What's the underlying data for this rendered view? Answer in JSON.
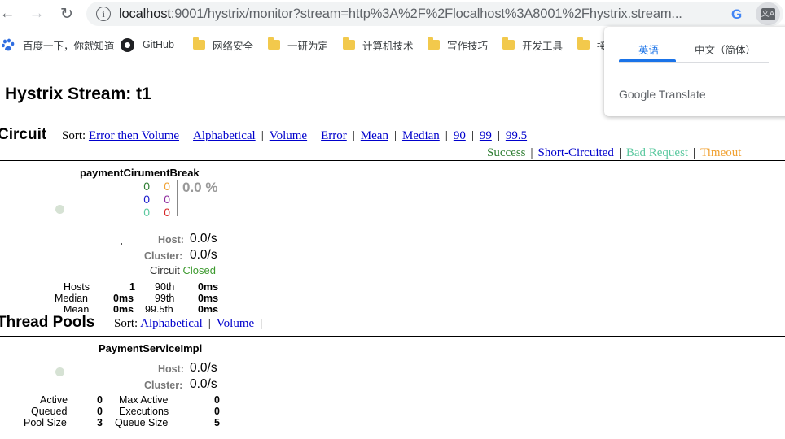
{
  "browser": {
    "back_icon": "arrow-left-icon",
    "forward_icon": "arrow-right-icon",
    "reload_icon": "reload-icon",
    "url_host": "localhost",
    "url_rest": ":9001/hystrix/monitor?stream=http%3A%2F%2Flocalhost%3A8001%2Fhystrix.stream...",
    "google_icon": "G",
    "translate_icon": "文A"
  },
  "bookmarks": [
    {
      "label": "百度一下，你就知道",
      "icon": "baidu-paw-icon"
    },
    {
      "label": "GitHub",
      "icon": "github-icon"
    },
    {
      "label": "网络安全",
      "icon": "folder-icon"
    },
    {
      "label": "一研为定",
      "icon": "folder-icon"
    },
    {
      "label": "计算机技术",
      "icon": "folder-icon"
    },
    {
      "label": "写作技巧",
      "icon": "folder-icon"
    },
    {
      "label": "开发工具",
      "icon": "folder-icon"
    },
    {
      "label": "接",
      "icon": "folder-icon"
    }
  ],
  "translate_popup": {
    "tab_source": "英语",
    "tab_target": "中文（简体）",
    "brand": "Google Translate"
  },
  "page": {
    "title": "Hystrix Stream: t1"
  },
  "circuit": {
    "heading": "Circuit",
    "sort_label": "Sort:",
    "sort_options": [
      "Error then Volume",
      "Alphabetical",
      "Volume",
      "Error",
      "Mean",
      "Median",
      "90",
      "99",
      "99.5"
    ],
    "legend": [
      {
        "label": "Success",
        "color": "#2e7d32"
      },
      {
        "label": "Short-Circuited",
        "color": "#0000cc"
      },
      {
        "label": "Bad Request",
        "color": "#5cc9a0"
      },
      {
        "label": "Timeout",
        "color": "#f0a030"
      }
    ],
    "name": "paymentCirumentBreak",
    "counts_left": [
      {
        "value": "0",
        "color": "#2e7d32"
      },
      {
        "value": "0",
        "color": "#1a1acc"
      },
      {
        "value": "0",
        "color": "#5cc9a0"
      }
    ],
    "counts_right": [
      {
        "value": "0",
        "color": "#f0a030"
      },
      {
        "value": "0",
        "color": "#8e2c9e"
      },
      {
        "value": "0",
        "color": "#d62728"
      }
    ],
    "error_pct": "0.0 %",
    "host_label": "Host:",
    "host_rate": "0.0/s",
    "cluster_label": "Cluster:",
    "cluster_rate": "0.0/s",
    "status_label": "Circuit",
    "status_value": "Closed",
    "stats": {
      "hosts_label": "Hosts",
      "hosts_value": "1",
      "median_label": "Median",
      "median_value": "0ms",
      "mean_label": "Mean",
      "mean_value": "0ms",
      "p90_label": "90th",
      "p90_value": "0ms",
      "p99_label": "99th",
      "p99_value": "0ms",
      "p995_label": "99.5th",
      "p995_value": "0ms"
    }
  },
  "thread_pools": {
    "heading": "Thread Pools",
    "sort_label": "Sort:",
    "sort_options": [
      "Alphabetical",
      "Volume"
    ],
    "name": "PaymentServiceImpl",
    "host_label": "Host:",
    "host_rate": "0.0/s",
    "cluster_label": "Cluster:",
    "cluster_rate": "0.0/s",
    "stats": {
      "active_label": "Active",
      "active_value": "0",
      "queued_label": "Queued",
      "queued_value": "0",
      "pool_size_label": "Pool Size",
      "pool_size_value": "3",
      "max_active_label": "Max Active",
      "max_active_value": "0",
      "executions_label": "Executions",
      "executions_value": "0",
      "queue_size_label": "Queue Size",
      "queue_size_value": "5"
    }
  }
}
